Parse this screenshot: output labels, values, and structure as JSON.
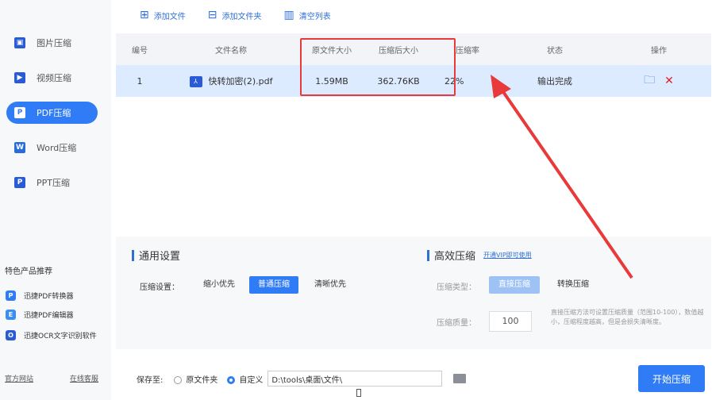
{
  "sidebar": {
    "items": [
      {
        "label": "图片压缩",
        "icon": "image-icon",
        "active": false
      },
      {
        "label": "视频压缩",
        "icon": "video-icon",
        "active": false
      },
      {
        "label": "PDF压缩",
        "icon": "pdf-icon",
        "active": true
      },
      {
        "label": "Word压缩",
        "icon": "word-icon",
        "active": false
      },
      {
        "label": "PPT压缩",
        "icon": "ppt-icon",
        "active": false
      }
    ],
    "promo_title": "特色产品推荐",
    "promo": [
      {
        "label": "迅捷PDF转换器"
      },
      {
        "label": "迅捷PDF编辑器"
      },
      {
        "label": "迅捷OCR文字识别软件"
      }
    ],
    "footer": {
      "website": "官方网站",
      "support": "在线客服"
    }
  },
  "toolbar": {
    "add_file": "添加文件",
    "add_folder": "添加文件夹",
    "clear_list": "清空列表"
  },
  "table": {
    "headers": [
      "编号",
      "文件名称",
      "原文件大小",
      "压缩后大小",
      "压缩率",
      "状态",
      "操作"
    ],
    "rows": [
      {
        "index": "1",
        "name": "快转加密(2).pdf",
        "original_size": "1.59MB",
        "compressed_size": "362.76KB",
        "ratio": "22%",
        "status": "输出完成"
      }
    ]
  },
  "settings": {
    "general_title": "通用设置",
    "compress_label": "压缩设置：",
    "options": [
      "缩小优先",
      "普通压缩",
      "清晰优先"
    ],
    "selected_option": "普通压缩",
    "efficient_title": "高效压缩",
    "vip_link": "开通VIP即可使用",
    "type_label": "压缩类型：",
    "type_options": [
      "直接压缩",
      "转换压缩"
    ],
    "quality_label": "压缩质量：",
    "quality_value": "100",
    "hint": "直接压缩方法可设置压缩质量（范围10-100），数值越小，压缩程度越高，但是会损失清晰度。"
  },
  "save": {
    "label": "保存至:",
    "option_original": "原文件夹",
    "option_custom": "自定义",
    "path": "D:\\tools\\桌面\\文件\\"
  },
  "start_button": "开始压缩",
  "colors": {
    "accent": "#2f7cf6",
    "highlight": "#e83a3a"
  }
}
